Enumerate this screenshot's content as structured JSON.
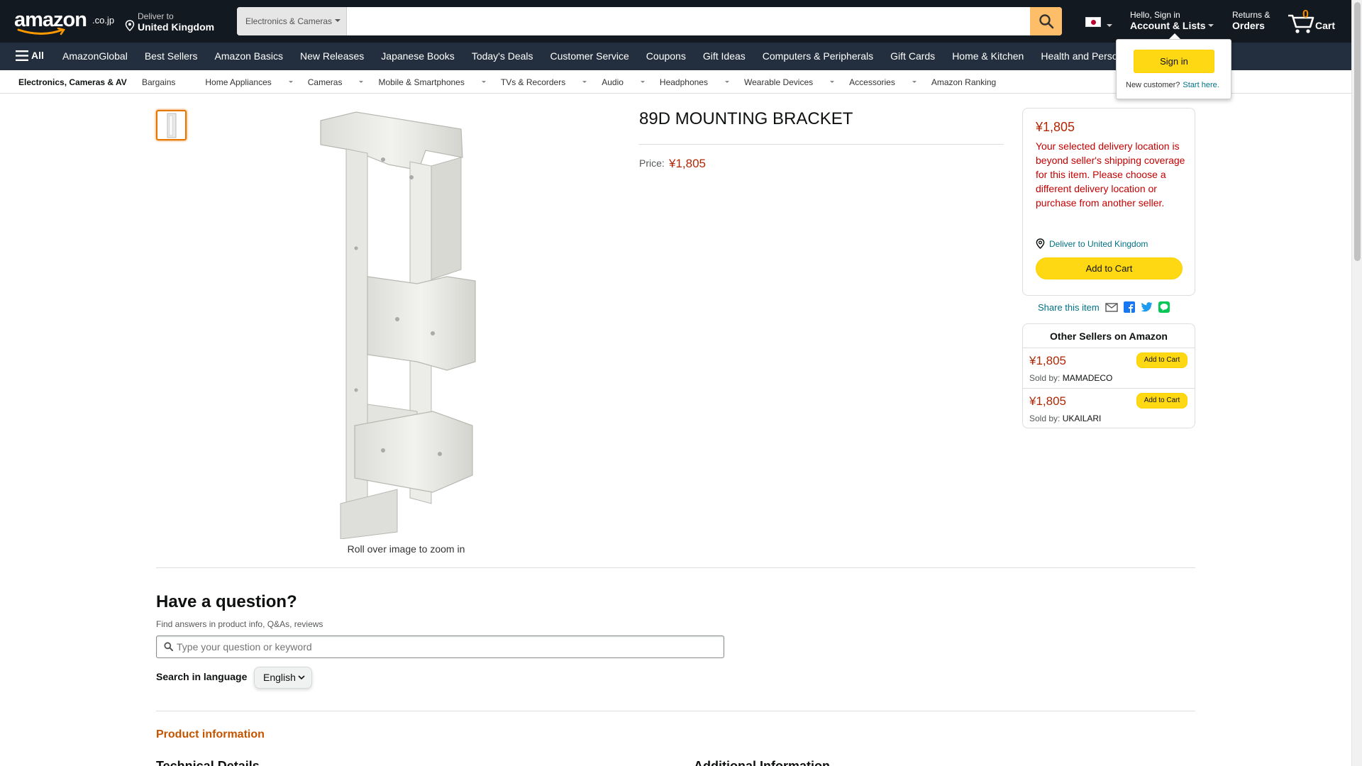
{
  "header": {
    "logo_word": "amazon",
    "logo_tld": ".co.jp",
    "deliver_line1": "Deliver to",
    "deliver_line2": "United Kingdom",
    "search_department": "Electronics & Cameras",
    "search_value": "",
    "account_line1": "Hello, Sign in",
    "account_line2": "Account & Lists",
    "returns_line1": "Returns &",
    "returns_line2": "Orders",
    "cart_count": "0",
    "cart_label": "Cart"
  },
  "subnav": {
    "all_label": "All",
    "items": [
      "AmazonGlobal",
      "Best Sellers",
      "Amazon Basics",
      "New Releases",
      "Japanese Books",
      "Today's Deals",
      "Customer Service",
      "Coupons",
      "Gift Ideas",
      "Computers & Peripherals",
      "Gift Cards",
      "Home & Kitchen",
      "Health and Personal Care"
    ]
  },
  "catnav": {
    "first": "Electronics, Cameras & AV",
    "items": [
      "Bargains",
      "Home Appliances",
      "Cameras",
      "Mobile & Smartphones",
      "TVs & Recorders",
      "Audio",
      "Headphones",
      "Wearable Devices",
      "Accessories",
      "Amazon Ranking"
    ]
  },
  "signin_flyout": {
    "button": "Sign in",
    "new_customer": "New customer?",
    "start_here": "Start here."
  },
  "product": {
    "title": "89D MOUNTING BRACKET",
    "price_label": "Price:",
    "price": "¥1,805",
    "zoom_hint": "Roll over image to zoom in"
  },
  "buybox": {
    "price": "¥1,805",
    "warning": "Your selected delivery location is beyond seller's shipping coverage for this item. Please choose a different delivery location or purchase from another seller.",
    "deliver_to": "Deliver to United Kingdom",
    "add_to_cart": "Add to Cart"
  },
  "share": {
    "label": "Share this item",
    "icons": [
      "email-icon",
      "facebook-icon",
      "twitter-icon",
      "line-icon"
    ]
  },
  "other_sellers": {
    "heading": "Other Sellers on Amazon",
    "sold_by_label": "Sold by:",
    "sellers": [
      {
        "price": "¥1,805",
        "name": "MAMADECO",
        "button": "Add to Cart"
      },
      {
        "price": "¥1,805",
        "name": "UKAILARI",
        "button": "Add to Cart"
      }
    ]
  },
  "question": {
    "title": "Have a question?",
    "subtitle": "Find answers in product info, Q&As, reviews",
    "placeholder": "Type your question or keyword",
    "language_label": "Search in language",
    "language_value": "English"
  },
  "product_info": {
    "heading": "Product information",
    "technical_details": "Technical Details",
    "additional_information": "Additional Information"
  },
  "colors": {
    "nav_bg": "#131921",
    "subnav_bg": "#232f3e",
    "price": "#b12704",
    "link": "#007185",
    "button_yellow": "#ffd814",
    "search_button": "#febd69",
    "section_heading": "#c45500"
  }
}
